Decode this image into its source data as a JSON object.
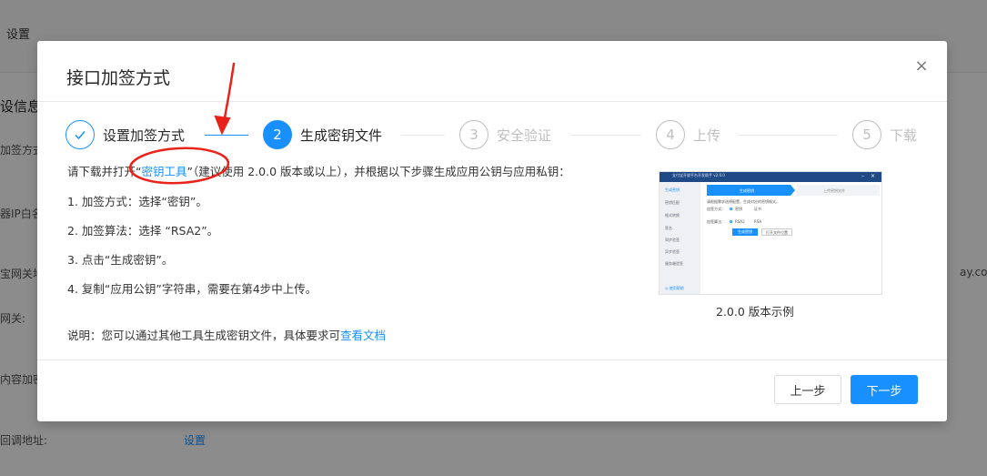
{
  "background": {
    "topbar_text": "设置",
    "section_title": "设信息",
    "labels": [
      "加签方式",
      "器IP白名",
      "宝网关地",
      "网关:",
      "内容加密",
      "回调地址:"
    ],
    "link": "设置",
    "right_text": "ay.com/g"
  },
  "modal": {
    "title": "接口加签方式",
    "close_icon": "×",
    "steps": [
      {
        "number": "",
        "label": "设置加签方式",
        "status": "done"
      },
      {
        "number": "2",
        "label": "生成密钥文件",
        "status": "active"
      },
      {
        "number": "3",
        "label": "安全验证",
        "status": "wait"
      },
      {
        "number": "4",
        "label": "上传",
        "status": "wait"
      },
      {
        "number": "5",
        "label": "下载",
        "status": "wait"
      }
    ],
    "intro": {
      "before": "请下载并打开",
      "open_quote": "“",
      "link": "密钥工具",
      "close_quote": "”",
      "after": "（建议使用 2.0.0 版本或以上），并根据以下步骤生成应用公钥与应用私钥："
    },
    "instructions": [
      "1. 加签方式：选择“密钥”。",
      "2. 加签算法：选择 “RSA2”。",
      "3. 点击“生成密钥”。",
      "4. 复制“应用公钥”字符串，需要在第4步中上传。"
    ],
    "note": {
      "text": "说明：您可以通过其他工具生成密钥文件，具体要求可",
      "link": "查看文档"
    },
    "example": {
      "window_title": "支付宝开放平台开发助手 v2.0.0",
      "sidebar": [
        "生成密钥",
        "密钥匹配",
        "格式转换",
        "签名",
        "同步验签",
        "异步验签",
        "服务端验签"
      ],
      "sidebar_footer": "◎ 使用帮助",
      "tab_active": "生成密钥",
      "tab_inactive": "上传密钥文件",
      "hint": "请根据需求选择配置，生成对应的密钥格式。",
      "row1_label": "加签方式：",
      "row1_opt1": "密钥",
      "row1_opt2": "证书",
      "row2_label": "加签算法：",
      "row2_opt1": "RSA2",
      "row2_opt2": "RSA",
      "btn_generate": "生成密钥",
      "btn_open": "打开文件位置",
      "caption": "2.0.0 版本示例"
    },
    "footer": {
      "prev": "上一步",
      "next": "下一步"
    }
  },
  "colors": {
    "primary": "#1890ff",
    "annotation": "#e8231a"
  }
}
